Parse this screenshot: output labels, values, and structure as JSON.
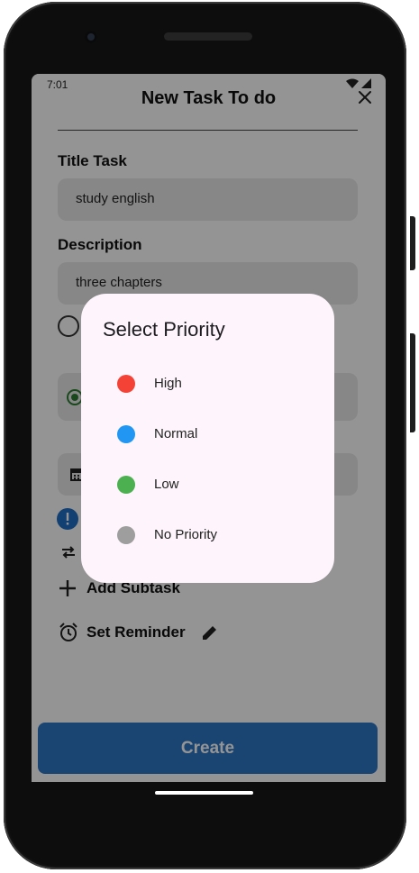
{
  "status_bar": {
    "time": "7:01"
  },
  "sheet": {
    "title": "New Task To do",
    "title_task_label": "Title Task",
    "title_task_value": "study english",
    "description_label": "Description",
    "description_value": "three chapters",
    "add_subtask_label": "Add Subtask",
    "set_reminder_label": "Set Reminder",
    "create_label": "Create"
  },
  "priority_dialog": {
    "title": "Select Priority",
    "options": [
      {
        "label": "High",
        "color": "#f44336"
      },
      {
        "label": "Normal",
        "color": "#2196f3"
      },
      {
        "label": "Low",
        "color": "#4caf50"
      },
      {
        "label": "No Priority",
        "color": "#9e9e9e"
      }
    ]
  },
  "colors": {
    "primary_button": "#2d78c7",
    "info_icon": "#1f6fc5",
    "category_radio": "#2e7d32"
  }
}
